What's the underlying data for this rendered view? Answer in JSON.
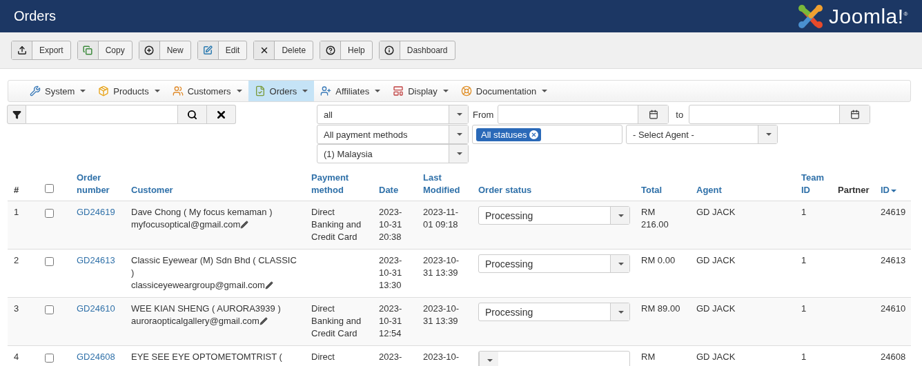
{
  "header": {
    "title": "Orders",
    "logo": "Joomla!",
    "logo_mark": "®"
  },
  "toolbar": [
    {
      "label": "Export",
      "kind": "export"
    },
    {
      "label": "Copy",
      "kind": "copy"
    },
    {
      "label": "New",
      "kind": "new"
    },
    {
      "label": "Edit",
      "kind": "edit"
    },
    {
      "label": "Delete",
      "kind": "delete"
    },
    {
      "label": "Help",
      "kind": "help"
    },
    {
      "label": "Dashboard",
      "kind": "dashboard"
    }
  ],
  "menu": [
    {
      "label": "System",
      "kind": "tools",
      "selected": false
    },
    {
      "label": "Products",
      "kind": "box",
      "selected": false
    },
    {
      "label": "Customers",
      "kind": "users",
      "selected": false
    },
    {
      "label": "Orders",
      "kind": "orders",
      "selected": true
    },
    {
      "label": "Affiliates",
      "kind": "affiliates",
      "selected": false
    },
    {
      "label": "Display",
      "kind": "display",
      "selected": false
    },
    {
      "label": "Documentation",
      "kind": "docs",
      "selected": false
    }
  ],
  "filters": {
    "status_select": "all",
    "payment_select": "All payment methods",
    "country_select": "(1) Malaysia",
    "from_label": "From",
    "to_label": "to",
    "status_tag": "All statuses",
    "agent_select": "- Select Agent -"
  },
  "table": {
    "columns": [
      {
        "label": "#",
        "kind": "plain"
      },
      {
        "kind": "checkbox",
        "checked": false
      },
      {
        "label": "Order number",
        "kind": "link"
      },
      {
        "label": "Customer",
        "kind": "link"
      },
      {
        "label": "Payment method",
        "kind": "link"
      },
      {
        "label": "Date",
        "kind": "link"
      },
      {
        "label": "Last Modified",
        "kind": "link"
      },
      {
        "label": "Order status",
        "kind": "link"
      },
      {
        "label": "Total",
        "kind": "link"
      },
      {
        "label": "Agent",
        "kind": "link"
      },
      {
        "label": "Team ID",
        "kind": "link"
      },
      {
        "label": "Partner",
        "kind": "plain"
      },
      {
        "label": "ID",
        "kind": "link",
        "sorted": true
      }
    ],
    "rows": [
      {
        "number": "1",
        "checked": false,
        "order": "GD24619",
        "customer": "Dave Chong ( My focus kemaman )",
        "email": "myfocusoptical@gmail.com",
        "payment": "Direct Banking and Credit Card",
        "date": "2023-10-31 20:38",
        "modified": "2023-11-01 09:18",
        "status": "Processing",
        "total": "RM 216.00",
        "agent": "GD JACK",
        "team": "1",
        "id": "24619"
      },
      {
        "number": "2",
        "checked": false,
        "order": "GD24613",
        "customer": "Classic Eyewear (M) Sdn Bhd ( CLASSIC )",
        "email": "classiceyeweargroup@gmail.com",
        "date": "2023-10-31 13:30",
        "modified": "2023-10-31 13:39",
        "status": "Processing",
        "total": "RM 0.00",
        "agent": "GD JACK",
        "team": "1",
        "id": "24613"
      },
      {
        "number": "3",
        "checked": false,
        "order": "GD24610",
        "customer": "WEE KIAN SHENG ( AURORA3939 )",
        "email": "auroraopticalgallery@gmail.com",
        "payment": "Direct Banking and Credit Card",
        "date": "2023-10-31 12:54",
        "modified": "2023-10-31 13:39",
        "status": "Processing",
        "total": "RM 89.00",
        "agent": "GD JACK",
        "team": "1",
        "id": "24610"
      },
      {
        "number": "4",
        "checked": false,
        "order": "GD24608",
        "customer": "EYE SEE EYE OPTOMETOMTRIST (",
        "payment": "Direct",
        "date": "2023-",
        "modified": "2023-10-",
        "total": "RM",
        "agent": "GD JACK",
        "team": "1",
        "id": "24608"
      }
    ]
  }
}
